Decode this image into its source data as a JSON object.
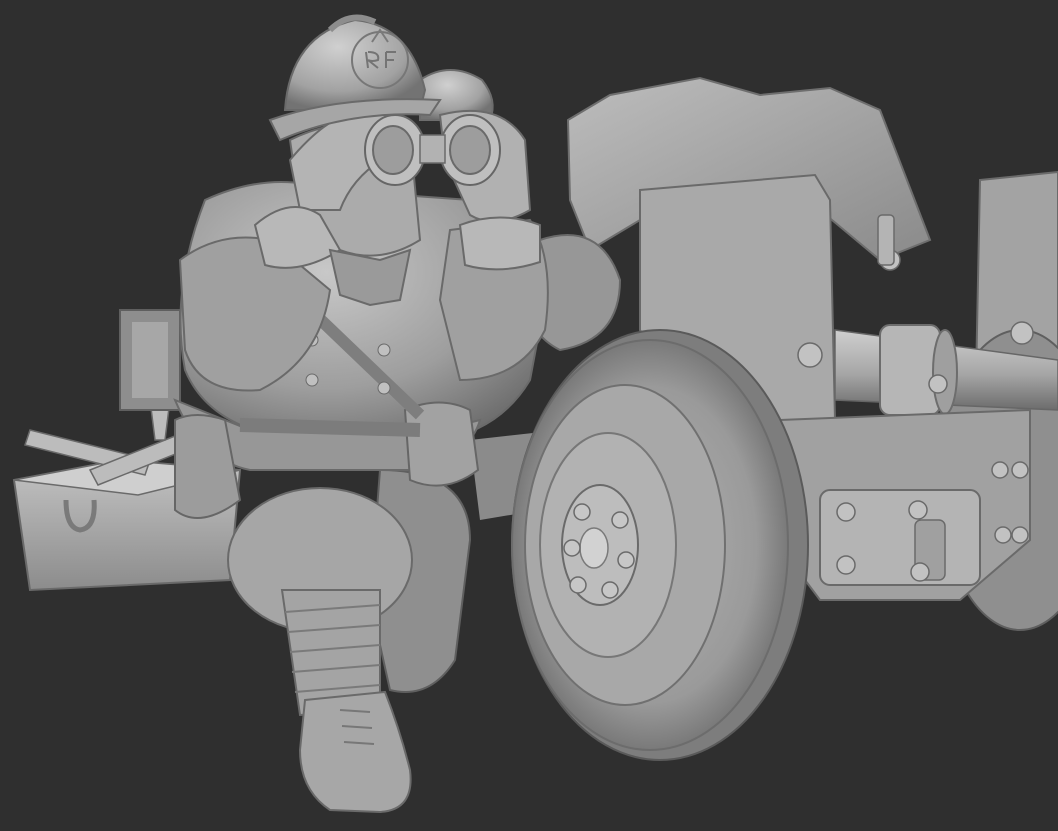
{
  "scene": {
    "subject": "sculpt-render",
    "background_color": "#2f2f2f",
    "clay_light": "#c4c4c4",
    "clay_mid": "#9d9d9d",
    "clay_dark": "#6d6d6d",
    "clay_shadow": "#4c4c4c"
  },
  "helmet": {
    "emblem_text": "RF"
  }
}
